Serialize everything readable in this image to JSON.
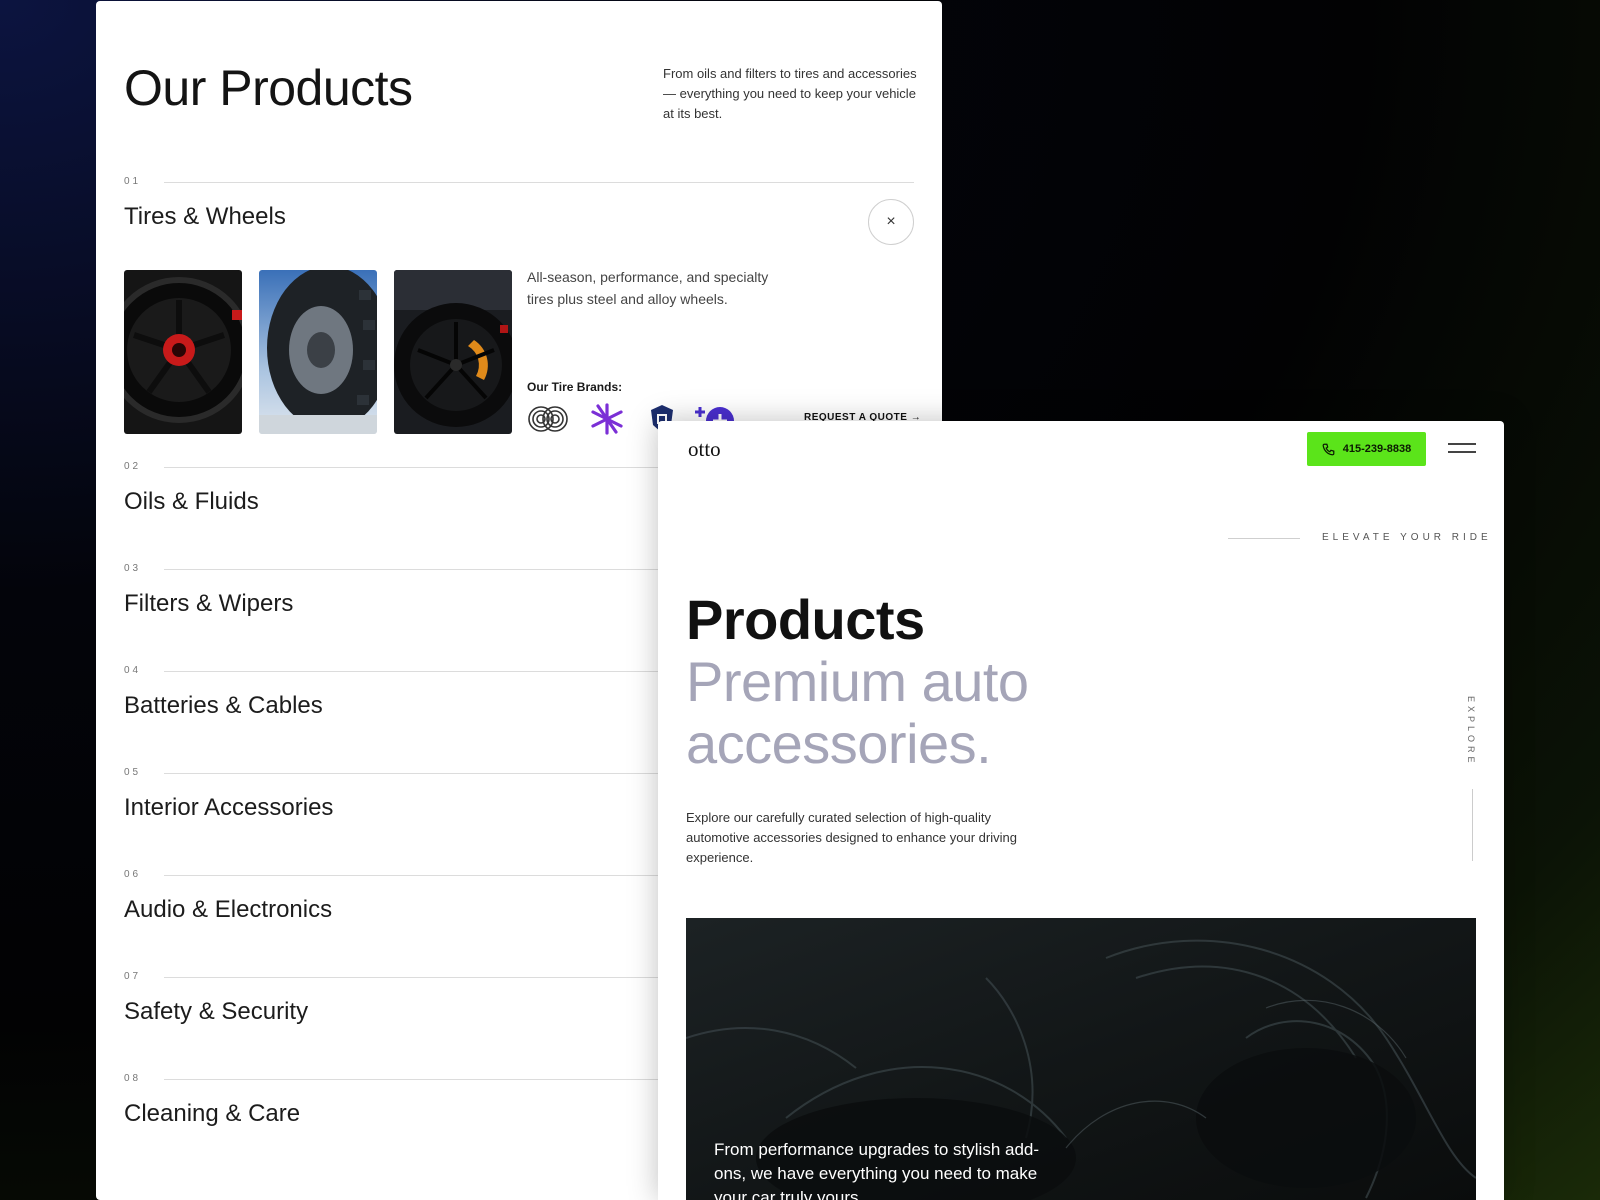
{
  "left_card": {
    "title": "Our Products",
    "description": "From oils and filters to tires and accessories — everything you need to keep your vehicle at its best.",
    "categories": [
      {
        "num": "01",
        "name": "Tires & Wheels"
      },
      {
        "num": "02",
        "name": "Oils & Fluids"
      },
      {
        "num": "03",
        "name": "Filters & Wipers"
      },
      {
        "num": "04",
        "name": "Batteries & Cables"
      },
      {
        "num": "05",
        "name": "Interior Accessories"
      },
      {
        "num": "06",
        "name": "Audio & Electronics"
      },
      {
        "num": "07",
        "name": "Safety & Security"
      },
      {
        "num": "08",
        "name": "Cleaning & Care"
      }
    ],
    "expanded": {
      "close_glyph": "×",
      "description": "All-season, performance, and specialty tires plus steel and alloy wheels.",
      "brands_label": "Our Tire Brands:",
      "quote_link": "REQUEST A QUOTE →"
    }
  },
  "right_card": {
    "logo": "otto",
    "phone": "415-239-8838",
    "tagline": "ELEVATE YOUR RIDE",
    "hero_title": "Products",
    "hero_subtitle": "Premium auto accessories.",
    "explore_label": "EXPLORE",
    "hero_description": "Explore our carefully curated selection of high-quality automotive accessories designed to enhance your driving experience.",
    "image_caption": "From performance upgrades to stylish add-ons, we have everything you need to make your car truly yours."
  },
  "colors": {
    "accent_green": "#5be41a",
    "subtitle_gray": "#a5a5b8",
    "brand_purple": "#7b2fd6",
    "brand_navy": "#1c2e6e"
  },
  "icons": [
    "close-icon",
    "phone-icon",
    "hamburger-menu-icon",
    "arrow-right-icon"
  ]
}
